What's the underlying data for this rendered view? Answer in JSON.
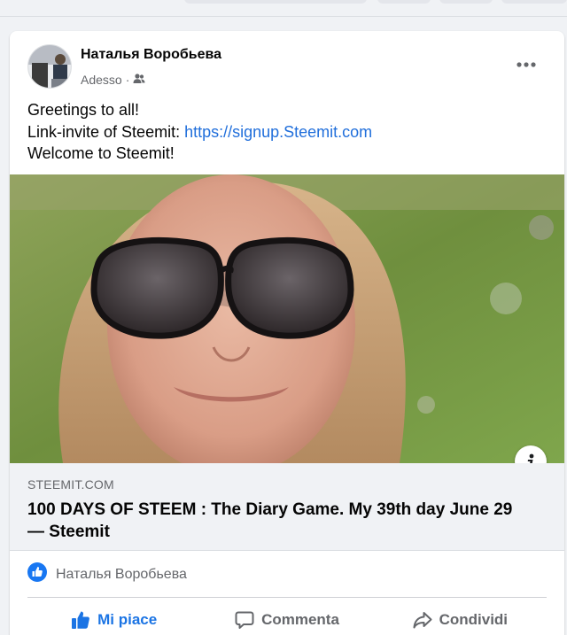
{
  "post": {
    "author": "Наталья Воробьева",
    "time": "Adesso",
    "audience_icon": "friends-icon",
    "text_lines": [
      "Greetings to all!",
      "Link-invite of Steemit: ",
      "Welcome to Steemit!"
    ],
    "link_text": "https://signup.Steemit.com"
  },
  "link_preview": {
    "domain": "STEEMIT.COM",
    "title": "100 DAYS OF STEEM : The Diary Game. My 39th day June 29 — Steemit"
  },
  "reactions": {
    "icon": "like-icon",
    "names": "Наталья Воробьева"
  },
  "actions": {
    "like": "Mi piace",
    "comment": "Commenta",
    "share": "Condividi"
  },
  "colors": {
    "accent": "#1b74e4",
    "link": "#216fdb",
    "secondary_text": "#65676b"
  }
}
